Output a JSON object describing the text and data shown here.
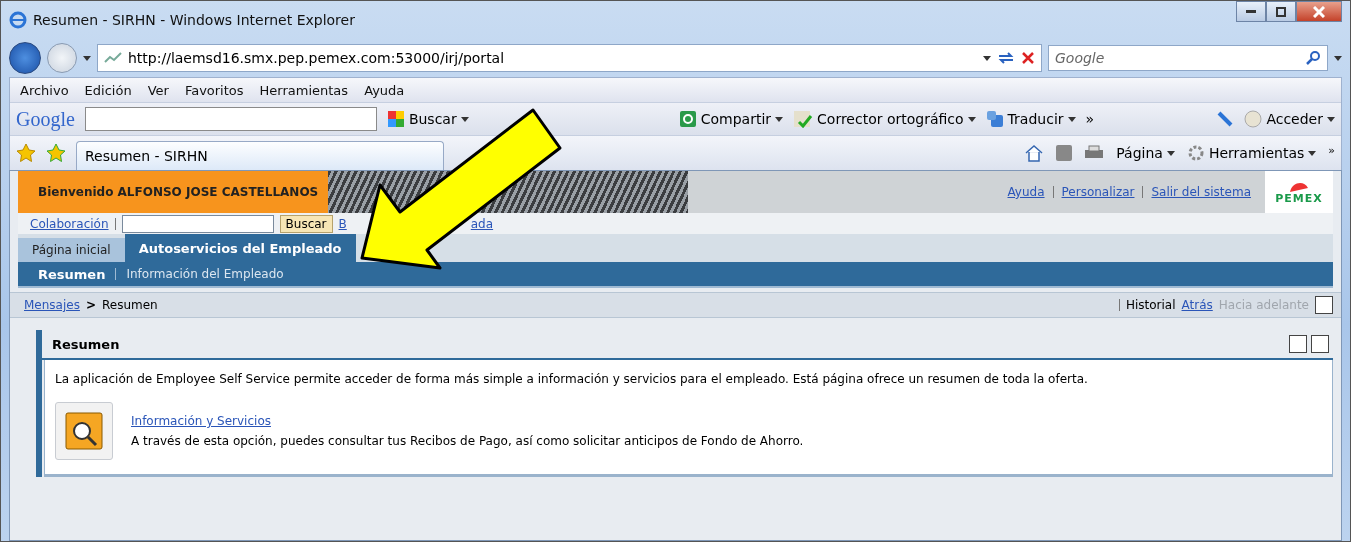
{
  "window": {
    "title": "Resumen - SIRHN - Windows Internet Explorer"
  },
  "address_bar": {
    "url": "http://laemsd16.smx.pep.pemex.com:53000/irj/portal"
  },
  "search_box": {
    "placeholder": "Google"
  },
  "menu_bar": [
    "Archivo",
    "Edición",
    "Ver",
    "Favoritos",
    "Herramientas",
    "Ayuda"
  ],
  "google_toolbar": {
    "logo": "Google",
    "items": [
      {
        "label": "Buscar",
        "kind": "search"
      },
      {
        "label": "Compartir",
        "kind": "share"
      },
      {
        "label": "Corrector ortográfico",
        "kind": "spell"
      },
      {
        "label": "Traducir",
        "kind": "translate"
      }
    ],
    "overflow": "»",
    "sign_in": "Acceder"
  },
  "browser_tabs": [
    {
      "label": "Resumen - SIRHN",
      "selected": true
    }
  ],
  "command_bar": {
    "page": "Página",
    "tools": "Herramientas",
    "overflow": "»"
  },
  "portal": {
    "welcome": "Bienvenido ALFONSO JOSE CASTELLANOS",
    "header_links": [
      "Ayuda",
      "Personalizar",
      "Salir del sistema"
    ],
    "logo": "PEMEX",
    "search_row": {
      "collaboration": "Colaboración",
      "button": "Buscar",
      "advanced_fragments": [
        "B",
        "ada"
      ]
    },
    "top_tabs": [
      {
        "label": "Página inicial",
        "selected": false
      },
      {
        "label": "Autoservicios del Empleado",
        "selected": true
      }
    ],
    "sub_tabs": [
      {
        "label": "Resumen",
        "selected": true
      },
      {
        "label": "Información del Empleado",
        "selected": false
      }
    ],
    "breadcrumb": {
      "link": "Mensajes",
      "separator": ">",
      "current": "Resumen"
    },
    "history": {
      "label": "Historial",
      "back": "Atrás",
      "forward": "Hacia adelante",
      "forward_disabled": true
    },
    "panel": {
      "title": "Resumen",
      "intro": "La aplicación de Employee Self Service permite acceder de forma más simple a información y servicios para el empleado. Está página ofrece un resumen de toda la oferta.",
      "entries": [
        {
          "link": "Información y Servicios",
          "description": "A través de esta opción, puedes consultar tus Recibos de Pago, así como solicitar anticipos de Fondo de Ahorro."
        }
      ]
    }
  }
}
